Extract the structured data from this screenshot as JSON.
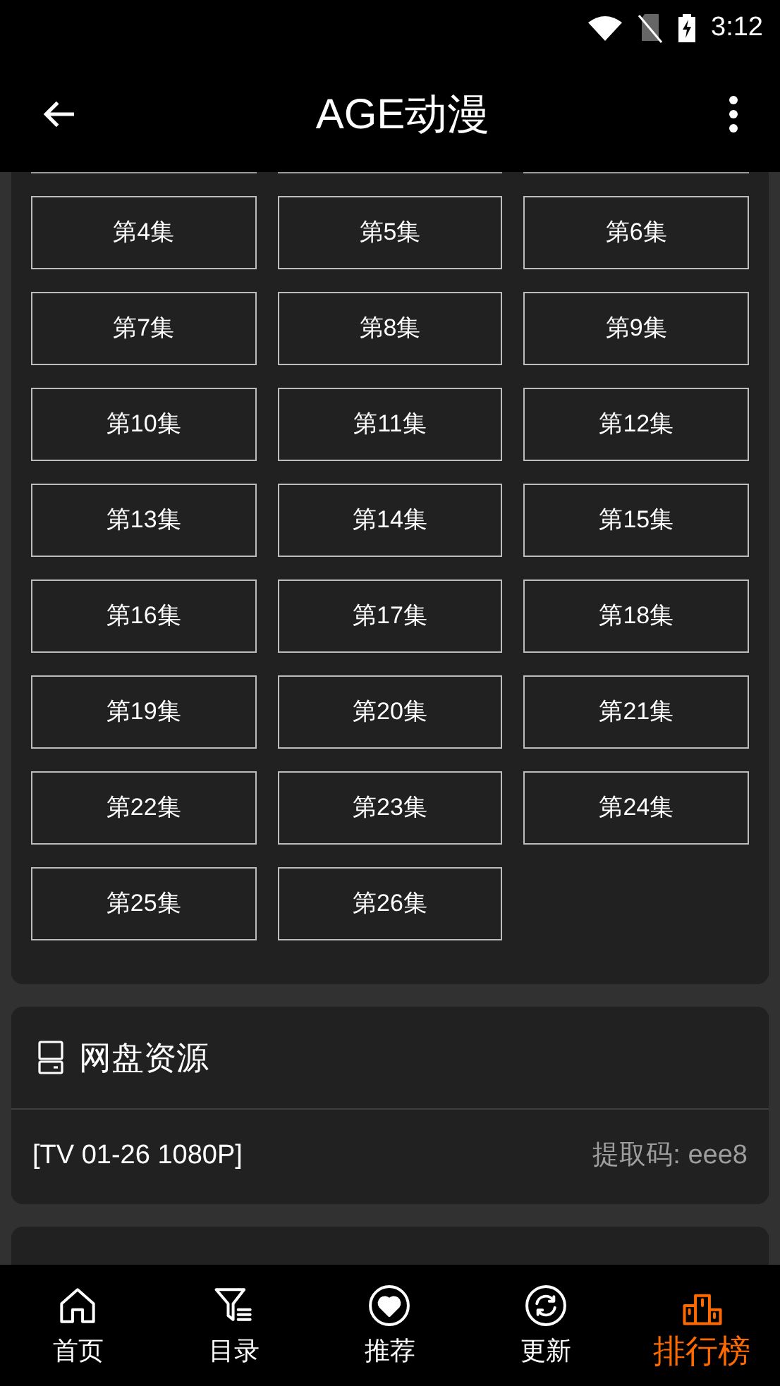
{
  "status_bar": {
    "time": "3:12"
  },
  "app_bar": {
    "title": "AGE动漫"
  },
  "episodes": [
    "第4集",
    "第5集",
    "第6集",
    "第7集",
    "第8集",
    "第9集",
    "第10集",
    "第11集",
    "第12集",
    "第13集",
    "第14集",
    "第15集",
    "第16集",
    "第17集",
    "第18集",
    "第19集",
    "第20集",
    "第21集",
    "第22集",
    "第23集",
    "第24集",
    "第25集",
    "第26集"
  ],
  "netdisk": {
    "title": "网盘资源",
    "items": [
      {
        "name": "[TV 01-26 1080P]",
        "code": "提取码: eee8"
      }
    ]
  },
  "bottom_nav": [
    {
      "kind": "home",
      "label": "首页",
      "selected": false
    },
    {
      "kind": "catalog",
      "label": "目录",
      "selected": false
    },
    {
      "kind": "recommend",
      "label": "推荐",
      "selected": false
    },
    {
      "kind": "update",
      "label": "更新",
      "selected": false
    },
    {
      "kind": "ranking",
      "label": "排行榜",
      "selected": true
    }
  ]
}
